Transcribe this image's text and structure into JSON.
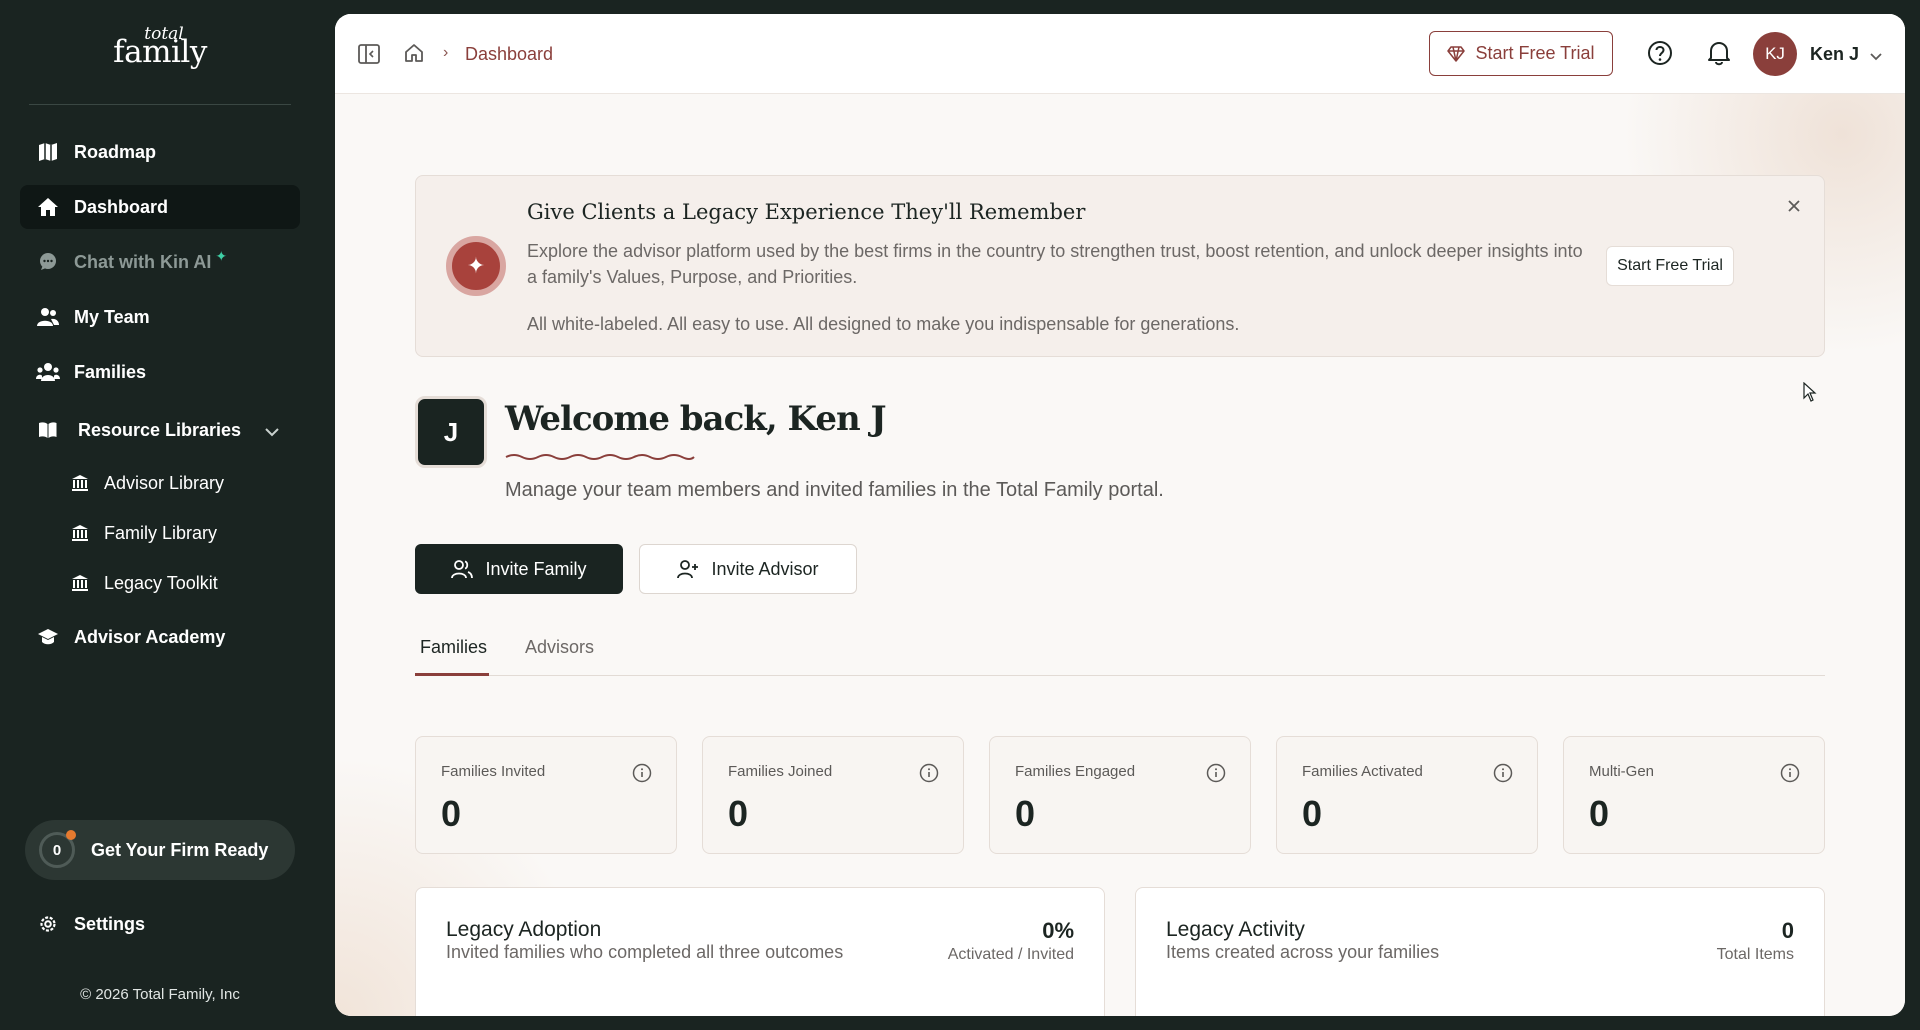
{
  "brand": {
    "logo_top": "total",
    "logo_bottom": "family"
  },
  "sidebar": {
    "items": [
      {
        "label": "Roadmap",
        "icon": "map-icon"
      },
      {
        "label": "Dashboard",
        "icon": "home-icon",
        "active": true
      },
      {
        "label": "Chat with Kin AI",
        "icon": "chat-icon"
      },
      {
        "label": "My Team",
        "icon": "users-icon"
      },
      {
        "label": "Families",
        "icon": "families-icon"
      },
      {
        "label": "Resource Libraries",
        "icon": "book-icon",
        "expanded": true
      },
      {
        "label": "Advisor Library",
        "icon": "library-icon"
      },
      {
        "label": "Family Library",
        "icon": "library-icon"
      },
      {
        "label": "Legacy Toolkit",
        "icon": "library-icon"
      },
      {
        "label": "Advisor Academy",
        "icon": "graduation-cap-icon"
      }
    ],
    "firm_ready": {
      "count": "0",
      "label": "Get Your Firm Ready"
    },
    "settings_label": "Settings",
    "copyright": "© 2026 Total Family, Inc"
  },
  "topbar": {
    "breadcrumb_current": "Dashboard",
    "trial_label": "Start Free Trial",
    "user_initials": "KJ",
    "user_name": "Ken J"
  },
  "banner": {
    "title": "Give Clients a Legacy Experience They'll Remember",
    "text": "Explore the advisor platform used by the best firms in the country to strengthen trust, boost retention, and unlock deeper insights into a family's Values, Purpose, and Priorities.",
    "text2": "All white-labeled. All easy to use. All designed to make you indispensable for generations.",
    "cta": "Start Free Trial"
  },
  "welcome": {
    "avatar_letter": "J",
    "title": "Welcome back, Ken J",
    "subtitle": "Manage your team members and invited families in the Total Family portal."
  },
  "actions": {
    "invite_family": "Invite Family",
    "invite_advisor": "Invite Advisor"
  },
  "tabs": [
    {
      "label": "Families",
      "active": true
    },
    {
      "label": "Advisors",
      "active": false
    }
  ],
  "stats": [
    {
      "label": "Families Invited",
      "value": "0"
    },
    {
      "label": "Families Joined",
      "value": "0"
    },
    {
      "label": "Families Engaged",
      "value": "0"
    },
    {
      "label": "Families Activated",
      "value": "0"
    },
    {
      "label": "Multi-Gen",
      "value": "0"
    }
  ],
  "cards": [
    {
      "title": "Legacy Adoption",
      "subtitle": "Invited families who completed all three outcomes",
      "value": "0%",
      "caption": "Activated / Invited"
    },
    {
      "title": "Legacy Activity",
      "subtitle": "Items created across your families",
      "value": "0",
      "caption": "Total Items"
    }
  ],
  "colors": {
    "sidebar_bg": "#1a2421",
    "accent": "#8a3f3b",
    "main_bg": "#faf8f6"
  }
}
